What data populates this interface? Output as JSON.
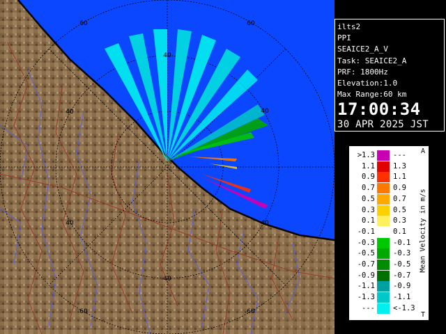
{
  "radar": {
    "range_ring_labels": [
      "40",
      "60"
    ],
    "colors": {
      "sea": "#0b47ff",
      "land": "#8a6e4c",
      "coast": "#000000",
      "rivers": "#5a62d8",
      "borders": "#9a3a2a",
      "rings": "#000000"
    }
  },
  "info": {
    "station": "ilts2",
    "product": "PPI",
    "scan": "SEAICE2_A_V",
    "task": "Task: SEAICE2_A",
    "prf": "PRF: 1800Hz",
    "elevation": "Elevation:1.0",
    "max_range": "Max Range:60 km",
    "time": "17:00:34",
    "date": "30 APR 2025 JST"
  },
  "legend": {
    "title": "Mean Velocity in m/s",
    "top_mark": "A",
    "bottom_mark": "T",
    "rows": [
      {
        "left": ">1.3",
        "right": "---",
        "color": "#c800b4"
      },
      {
        "left": "1.1",
        "right": "1.3",
        "color": "#e00000"
      },
      {
        "left": "0.9",
        "right": "1.1",
        "color": "#ff3000"
      },
      {
        "left": "0.7",
        "right": "0.9",
        "color": "#ff7800"
      },
      {
        "left": "0.5",
        "right": "0.7",
        "color": "#ffa800"
      },
      {
        "left": "0.3",
        "right": "0.5",
        "color": "#ffd000"
      },
      {
        "left": "0.1",
        "right": "0.3",
        "color": "#fff060"
      },
      {
        "left": "-0.1",
        "right": "0.1",
        "color": "#ffffff"
      },
      {
        "left": "-0.3",
        "right": "-0.1",
        "color": "#00c800"
      },
      {
        "left": "-0.5",
        "right": "-0.3",
        "color": "#00a800"
      },
      {
        "left": "-0.7",
        "right": "-0.5",
        "color": "#008c00"
      },
      {
        "left": "-0.9",
        "right": "-0.7",
        "color": "#007000"
      },
      {
        "left": "-1.1",
        "right": "-0.9",
        "color": "#00a0a0"
      },
      {
        "left": "-1.3",
        "right": "-1.1",
        "color": "#00c8c8"
      },
      {
        "left": "---",
        "right": "<-1.3",
        "color": "#00f0f0"
      }
    ]
  }
}
